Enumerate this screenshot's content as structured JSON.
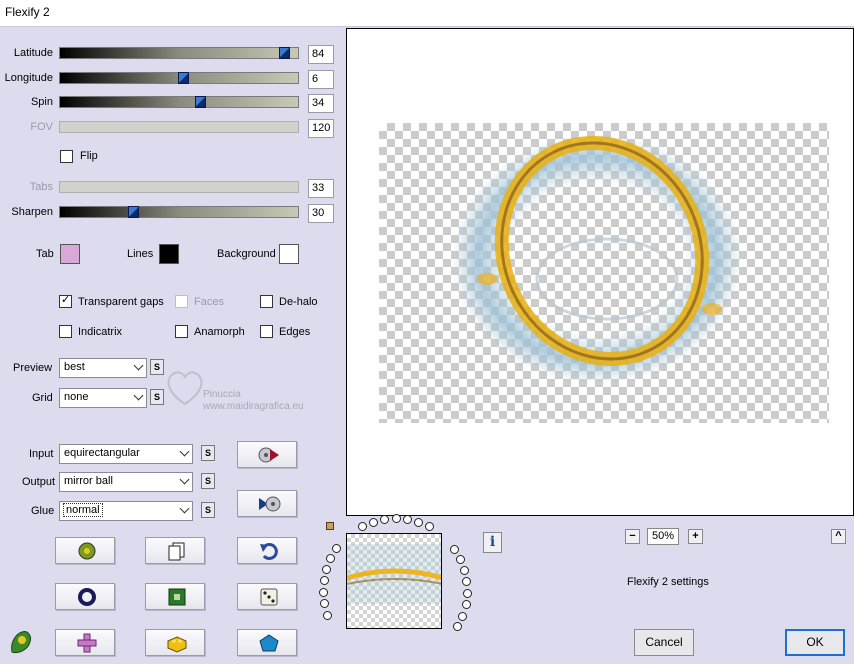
{
  "window": {
    "title": "Flexify 2"
  },
  "sliders": {
    "latitude": {
      "label": "Latitude",
      "value": "84",
      "level": 0.94
    },
    "longitude": {
      "label": "Longitude",
      "value": "6",
      "level": 0.52
    },
    "spin": {
      "label": "Spin",
      "value": "34",
      "level": 0.59
    },
    "fov": {
      "label": "FOV",
      "value": "120",
      "disabled": true
    },
    "tabs": {
      "label": "Tabs",
      "value": "33",
      "disabled": true
    },
    "sharpen": {
      "label": "Sharpen",
      "value": "30",
      "level": 0.31
    }
  },
  "flip": {
    "label": "Flip",
    "checked": false
  },
  "colors": {
    "tab": {
      "label": "Tab",
      "color": "#d8a8d8"
    },
    "lines": {
      "label": "Lines",
      "color": "#000000"
    },
    "background": {
      "label": "Background",
      "color": "#ffffff"
    }
  },
  "options": {
    "transparent_gaps": {
      "label": "Transparent gaps",
      "checked": true
    },
    "faces": {
      "label": "Faces",
      "checked": false,
      "disabled": true
    },
    "de_halo": {
      "label": "De-halo",
      "checked": false
    },
    "indicatrix": {
      "label": "Indicatrix",
      "checked": false
    },
    "anamorph": {
      "label": "Anamorph",
      "checked": false
    },
    "edges": {
      "label": "Edges",
      "checked": false
    }
  },
  "dropdowns": {
    "preview": {
      "label": "Preview",
      "value": "best"
    },
    "grid": {
      "label": "Grid",
      "value": "none"
    },
    "input": {
      "label": "Input",
      "value": "equirectangular"
    },
    "output": {
      "label": "Output",
      "value": "mirror ball"
    },
    "glue": {
      "label": "Glue",
      "value": "normal"
    }
  },
  "small_button_label": "S",
  "watermark": {
    "line1": "Pinuccia",
    "line2": "www.maidiragrafica.eu"
  },
  "zoom": {
    "minus": "−",
    "value": "50%",
    "plus": "+"
  },
  "settings_label": "Flexify 2 settings",
  "buttons": {
    "cancel": "Cancel",
    "ok": "OK",
    "info": "i",
    "up": "^"
  },
  "icons": {
    "load": "film-disc-play-icon",
    "save": "play-disc-icon",
    "randomize": "random-globe-icon",
    "copy": "copy-pages-icon",
    "undo": "undo-arrow-icon",
    "ring": "ring-icon",
    "square": "green-square-icon",
    "dice": "dice-icon",
    "cross": "pink-cross-icon",
    "brick": "yellow-brick-icon",
    "pentagon": "blue-pentagon-icon",
    "logo": "flexify-logo-icon"
  },
  "accent": "#1f6fcf"
}
